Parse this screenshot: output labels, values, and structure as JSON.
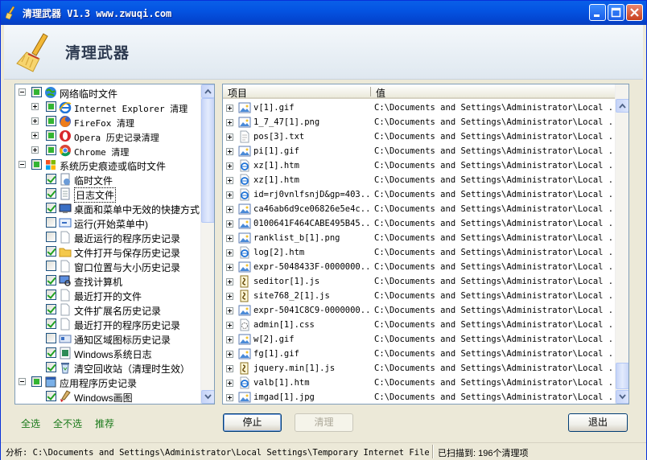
{
  "window": {
    "title": "清理武器 V1.3 www.zwuqi.com"
  },
  "header": {
    "title": "清理武器"
  },
  "tree": [
    {
      "label": "网络临时文件",
      "level": 0,
      "expander": "minus",
      "check": "part",
      "icon": "globe-icon",
      "mono": false
    },
    {
      "label": "Internet Explorer 清理",
      "level": 1,
      "expander": "plus",
      "check": "part",
      "icon": "ie-icon",
      "mono": true
    },
    {
      "label": "FireFox 清理",
      "level": 1,
      "expander": "plus",
      "check": "part",
      "icon": "firefox-icon",
      "mono": true
    },
    {
      "label": "Opera 历史记录清理",
      "level": 1,
      "expander": "plus",
      "check": "part",
      "icon": "opera-icon",
      "mono": true
    },
    {
      "label": "Chrome 清理",
      "level": 1,
      "expander": "plus",
      "check": "part",
      "icon": "chrome-icon",
      "mono": true
    },
    {
      "label": "系统历史痕迹或临时文件",
      "level": 0,
      "expander": "minus",
      "check": "part",
      "icon": "windows-icon",
      "mono": false
    },
    {
      "label": "临时文件",
      "level": 2,
      "expander": "none",
      "check": "on",
      "icon": "temp-files-icon",
      "mono": false
    },
    {
      "label": "日志文件",
      "level": 2,
      "expander": "none",
      "check": "on",
      "icon": "document-icon",
      "mono": false
    },
    {
      "label": "桌面和菜单中无效的快捷方式",
      "level": 2,
      "expander": "none",
      "check": "on",
      "icon": "desktop-icon",
      "mono": false
    },
    {
      "label": "运行(开始菜单中)",
      "level": 2,
      "expander": "none",
      "check": "off",
      "icon": "run-icon",
      "mono": false
    },
    {
      "label": "最近运行的程序历史记录",
      "level": 2,
      "expander": "none",
      "check": "off",
      "icon": "blank-file-icon",
      "mono": false
    },
    {
      "label": "文件打开与保存历史记录",
      "level": 2,
      "expander": "none",
      "check": "on",
      "icon": "folder-icon",
      "mono": false
    },
    {
      "label": "窗口位置与大小历史记录",
      "level": 2,
      "expander": "none",
      "check": "off",
      "icon": "blank-file-icon",
      "mono": false
    },
    {
      "label": "查找计算机",
      "level": 2,
      "expander": "none",
      "check": "on",
      "icon": "search-computer-icon",
      "mono": false
    },
    {
      "label": "最近打开的文件",
      "level": 2,
      "expander": "none",
      "check": "on",
      "icon": "blank-file-icon",
      "mono": false
    },
    {
      "label": "文件扩展名历史记录",
      "level": 2,
      "expander": "none",
      "check": "on",
      "icon": "blank-file-icon",
      "mono": false
    },
    {
      "label": "最近打开的程序历史记录",
      "level": 2,
      "expander": "none",
      "check": "on",
      "icon": "blank-file-icon",
      "mono": false
    },
    {
      "label": "通知区域图标历史记录",
      "level": 2,
      "expander": "none",
      "check": "off",
      "icon": "tray-icon",
      "mono": false
    },
    {
      "label": "Windows系统日志",
      "level": 2,
      "expander": "none",
      "check": "on",
      "icon": "log-icon",
      "mono": false
    },
    {
      "label": "清空回收站（清理时生效）",
      "level": 2,
      "expander": "none",
      "check": "on",
      "icon": "recycle-bin-icon",
      "mono": false
    },
    {
      "label": "应用程序历史记录",
      "level": 0,
      "expander": "minus",
      "check": "part",
      "icon": "app-icon",
      "mono": false
    },
    {
      "label": "Windows画图",
      "level": 2,
      "expander": "none",
      "check": "on",
      "icon": "paint-icon",
      "mono": false
    }
  ],
  "list": {
    "col_item": "项目",
    "col_value": "值",
    "rows": [
      {
        "name": "v[1].gif",
        "value": "C:\\Documents and Settings\\Administrator\\Local ...",
        "icon": "image-file-icon"
      },
      {
        "name": "1_7_47[1].png",
        "value": "C:\\Documents and Settings\\Administrator\\Local ...",
        "icon": "image-file-icon"
      },
      {
        "name": "pos[3].txt",
        "value": "C:\\Documents and Settings\\Administrator\\Local ...",
        "icon": "text-file-icon"
      },
      {
        "name": "pi[1].gif",
        "value": "C:\\Documents and Settings\\Administrator\\Local ...",
        "icon": "image-file-icon"
      },
      {
        "name": "xz[1].htm",
        "value": "C:\\Documents and Settings\\Administrator\\Local ...",
        "icon": "html-file-icon"
      },
      {
        "name": "xz[1].htm",
        "value": "C:\\Documents and Settings\\Administrator\\Local ...",
        "icon": "html-file-icon"
      },
      {
        "name": "id=rj0vnlfsnjD&gp=403...",
        "value": "C:\\Documents and Settings\\Administrator\\Local ...",
        "icon": "html-file-icon"
      },
      {
        "name": "ca46ab6d9ce06826e5e4c...",
        "value": "C:\\Documents and Settings\\Administrator\\Local ...",
        "icon": "image-file-icon"
      },
      {
        "name": "0100641F464CABE495B45...",
        "value": "C:\\Documents and Settings\\Administrator\\Local ...",
        "icon": "image-file-icon"
      },
      {
        "name": "ranklist_b[1].png",
        "value": "C:\\Documents and Settings\\Administrator\\Local ...",
        "icon": "image-file-icon"
      },
      {
        "name": "log[2].htm",
        "value": "C:\\Documents and Settings\\Administrator\\Local ...",
        "icon": "html-file-icon"
      },
      {
        "name": "expr-5048433F-0000000...",
        "value": "C:\\Documents and Settings\\Administrator\\Local ...",
        "icon": "image-file-icon"
      },
      {
        "name": "seditor[1].js",
        "value": "C:\\Documents and Settings\\Administrator\\Local ...",
        "icon": "script-file-icon"
      },
      {
        "name": "site768_2[1].js",
        "value": "C:\\Documents and Settings\\Administrator\\Local ...",
        "icon": "script-file-icon"
      },
      {
        "name": "expr-5041C8C9-0000000...",
        "value": "C:\\Documents and Settings\\Administrator\\Local ...",
        "icon": "image-file-icon"
      },
      {
        "name": "admin[1].css",
        "value": "C:\\Documents and Settings\\Administrator\\Local ...",
        "icon": "css-file-icon"
      },
      {
        "name": "w[2].gif",
        "value": "C:\\Documents and Settings\\Administrator\\Local ...",
        "icon": "image-file-icon"
      },
      {
        "name": "fg[1].gif",
        "value": "C:\\Documents and Settings\\Administrator\\Local ...",
        "icon": "image-file-icon"
      },
      {
        "name": "jquery.min[1].js",
        "value": "C:\\Documents and Settings\\Administrator\\Local ...",
        "icon": "script-file-icon"
      },
      {
        "name": "valb[1].htm",
        "value": "C:\\Documents and Settings\\Administrator\\Local ...",
        "icon": "html-file-icon"
      },
      {
        "name": "imgad[1].jpg",
        "value": "C:\\Documents and Settings\\Administrator\\Local ...",
        "icon": "image-file-icon"
      }
    ]
  },
  "links": {
    "select_all": "全选",
    "select_none": "全不选",
    "recommend": "推荐"
  },
  "buttons": {
    "stop": "停止",
    "clean": "清理",
    "exit": "退出"
  },
  "status": {
    "path": "分析: C:\\Documents and Settings\\Administrator\\Local Settings\\Temporary Internet Files\\Co",
    "count": "已扫描到: 196个清理项"
  },
  "colors": {
    "titlebar": "#0454e2",
    "link": "#1a7a1a",
    "check": "#21a121"
  }
}
